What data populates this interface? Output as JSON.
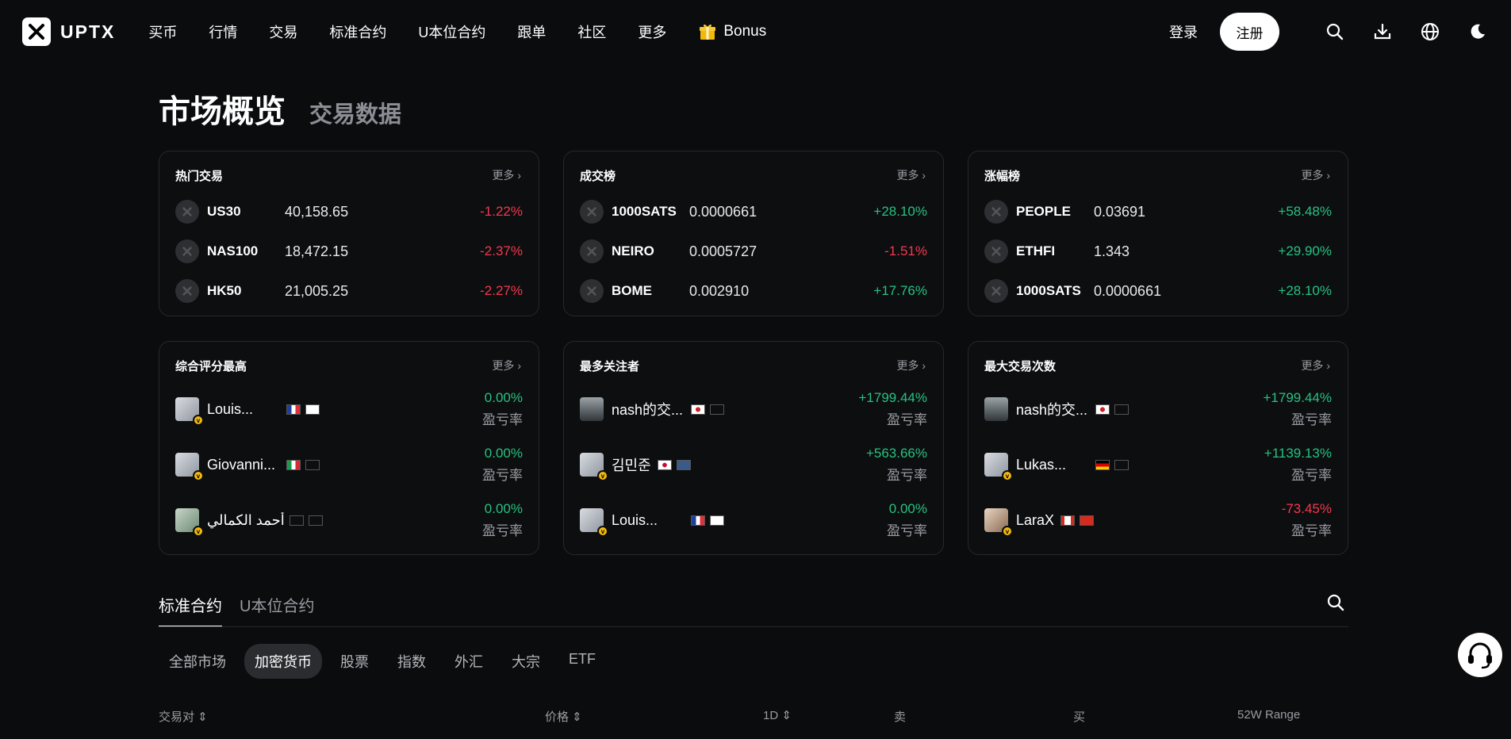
{
  "brand": {
    "name": "UPTX"
  },
  "nav": {
    "items": [
      "买币",
      "行情",
      "交易",
      "标准合约",
      "U本位合约",
      "跟单",
      "社区",
      "更多"
    ],
    "bonus": "Bonus",
    "login": "登录",
    "register": "注册"
  },
  "heading": {
    "main": "市场概览",
    "sub": "交易数据"
  },
  "more_label": "更多 ›",
  "hot": {
    "title": "热门交易",
    "rows": [
      {
        "symbol": "US30",
        "price": "40,158.65",
        "change": "-1.22%",
        "dir": "down"
      },
      {
        "symbol": "NAS100",
        "price": "18,472.15",
        "change": "-2.37%",
        "dir": "down"
      },
      {
        "symbol": "HK50",
        "price": "21,005.25",
        "change": "-2.27%",
        "dir": "down"
      }
    ]
  },
  "volume": {
    "title": "成交榜",
    "rows": [
      {
        "symbol": "1000SATS",
        "price": "0.0000661",
        "change": "+28.10%",
        "dir": "up"
      },
      {
        "symbol": "NEIRO",
        "price": "0.0005727",
        "change": "-1.51%",
        "dir": "down"
      },
      {
        "symbol": "BOME",
        "price": "0.002910",
        "change": "+17.76%",
        "dir": "up"
      }
    ]
  },
  "gainers": {
    "title": "涨幅榜",
    "rows": [
      {
        "symbol": "PEOPLE",
        "price": "0.03691",
        "change": "+58.48%",
        "dir": "up"
      },
      {
        "symbol": "ETHFI",
        "price": "1.343",
        "change": "+29.90%",
        "dir": "up"
      },
      {
        "symbol": "1000SATS",
        "price": "0.0000661",
        "change": "+28.10%",
        "dir": "up"
      }
    ]
  },
  "profit_label": "盈亏率",
  "top_rated": {
    "title": "综合评分最高",
    "rows": [
      {
        "name": "Louis...",
        "pct": "0.00%",
        "dir": "up",
        "flag": "france-flag"
      },
      {
        "name": "Giovanni...",
        "pct": "0.00%",
        "dir": "up",
        "flag": "italy-flag"
      },
      {
        "name": "أحمد الكمالي",
        "pct": "0.00%",
        "dir": "up",
        "flag": "blank-flag"
      }
    ]
  },
  "most_followed": {
    "title": "最多关注者",
    "rows": [
      {
        "name": "nash的交...",
        "pct": "+1799.44%",
        "dir": "up",
        "flag": "japan-flag"
      },
      {
        "name": "김민준",
        "pct": "+563.66%",
        "dir": "up",
        "flag": "korea-flag"
      },
      {
        "name": "Louis...",
        "pct": "0.00%",
        "dir": "up",
        "flag": "france-flag"
      }
    ]
  },
  "most_trades": {
    "title": "最大交易次数",
    "rows": [
      {
        "name": "nash的交...",
        "pct": "+1799.44%",
        "dir": "up",
        "flag": "japan-flag"
      },
      {
        "name": "Lukas...",
        "pct": "+1139.13%",
        "dir": "up",
        "flag": "germany-flag"
      },
      {
        "name": "LaraX",
        "pct": "-73.45%",
        "dir": "down",
        "flag": "canada-flag"
      }
    ]
  },
  "tabs": [
    "标准合约",
    "U本位合约"
  ],
  "filters": [
    "全部市场",
    "加密货币",
    "股票",
    "指数",
    "外汇",
    "大宗",
    "ETF"
  ],
  "columns": [
    "交易对 ⇕",
    "价格 ⇕",
    "1D ⇕",
    "卖",
    "买",
    "52W Range"
  ],
  "colors": {
    "up": "#26c281",
    "down": "#f03a4d",
    "badge": "#f2b80d"
  }
}
